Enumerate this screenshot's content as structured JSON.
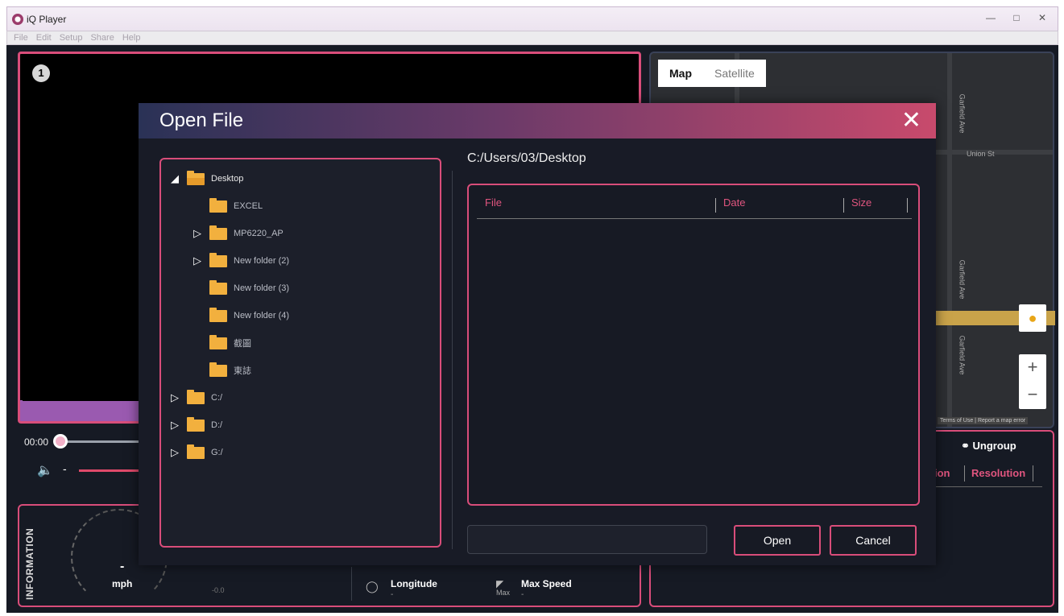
{
  "window": {
    "title": "iQ Player",
    "controls": [
      "—",
      "□",
      "✕"
    ]
  },
  "menu": [
    "File",
    "Edit",
    "Setup",
    "Share",
    "Help"
  ],
  "video": {
    "channel": "1",
    "time": "00:00",
    "volume_minus": "-"
  },
  "info": {
    "label": "INFORMATION",
    "speed": "-",
    "speed_unit": "mph",
    "small_value": "-0.0",
    "longitude_label": "Longitude",
    "longitude_value": "-",
    "max_speed_label": "Max Speed",
    "max_speed_icon_sub": "Max",
    "max_speed_value": "-"
  },
  "map": {
    "tabs": [
      {
        "label": "Map",
        "active": true
      },
      {
        "label": "Satellite",
        "active": false
      }
    ],
    "streets": [
      "Union St",
      "Garfield Ave",
      "Garfield Ave",
      "Garfield Ave"
    ],
    "footer": "Terms of Use | Report a map error",
    "zoom_in": "+",
    "zoom_out": "−"
  },
  "right_panel": {
    "ungroup_label": "Ungroup",
    "col_partial": "ion",
    "col_resolution": "Resolution"
  },
  "dialog": {
    "title": "Open File",
    "close": "✕",
    "path": "C:/Users/03/Desktop",
    "tree": [
      {
        "label": "Desktop",
        "expander": "◢",
        "open": true
      },
      {
        "label": "EXCEL",
        "expander": ""
      },
      {
        "label": "MP6220_AP",
        "expander": "▷"
      },
      {
        "label": "New folder (2)",
        "expander": "▷"
      },
      {
        "label": "New folder (3)",
        "expander": ""
      },
      {
        "label": "New folder (4)",
        "expander": ""
      },
      {
        "label": "截圖",
        "expander": ""
      },
      {
        "label": "東誌",
        "expander": ""
      },
      {
        "label": "C:/",
        "expander": "▷"
      },
      {
        "label": "D:/",
        "expander": "▷"
      },
      {
        "label": "G:/",
        "expander": "▷"
      }
    ],
    "columns": {
      "file": "File",
      "date": "Date",
      "size": "Size"
    },
    "filename_value": "",
    "open_label": "Open",
    "cancel_label": "Cancel"
  },
  "colors": {
    "accent": "#d94d7a",
    "header_left": "#2a3256",
    "header_right": "#c84a6c",
    "folder": "#f2b03e"
  }
}
